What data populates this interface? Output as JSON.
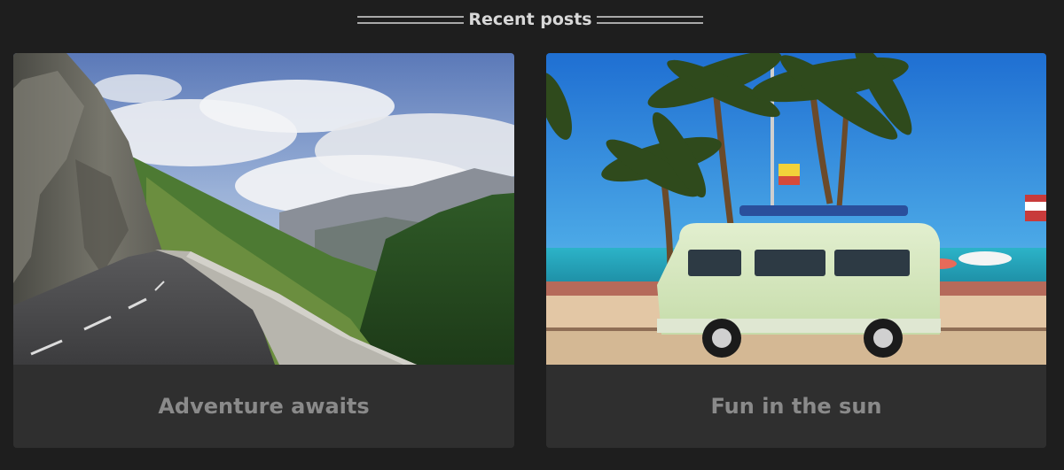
{
  "section": {
    "title": "Recent posts"
  },
  "posts": [
    {
      "title": "Adventure awaits",
      "image": "mountain-road-image"
    },
    {
      "title": "Fun in the sun",
      "image": "beach-van-image"
    }
  ]
}
